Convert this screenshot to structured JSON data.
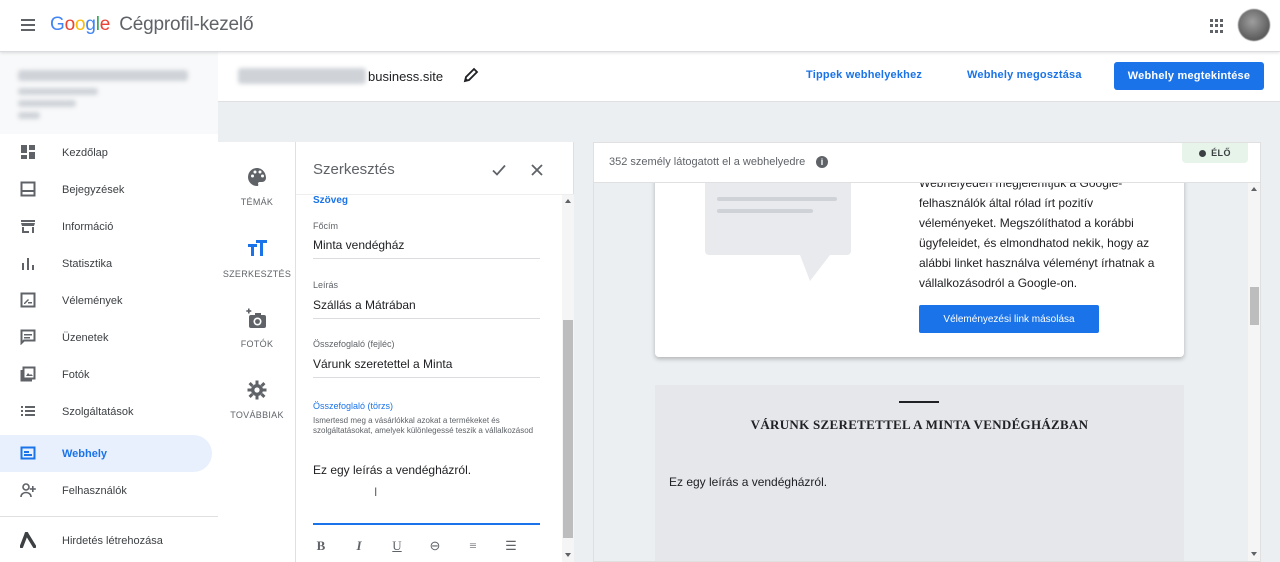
{
  "topbar": {
    "logo": {
      "G": "G",
      "o1": "o",
      "o2": "o",
      "g": "g",
      "l": "l",
      "e": "e"
    },
    "product_name": "Cégprofil-kezelő",
    "icons": {
      "menu": "menu-icon",
      "apps": "apps-grid-icon",
      "avatar": "account-avatar"
    }
  },
  "sidebar": {
    "items": [
      {
        "label": "Kezdőlap",
        "icon": "dashboard-icon"
      },
      {
        "label": "Bejegyzések",
        "icon": "posts-icon"
      },
      {
        "label": "Információ",
        "icon": "store-icon"
      },
      {
        "label": "Statisztika",
        "icon": "bar-chart-icon"
      },
      {
        "label": "Vélemények",
        "icon": "reviews-icon"
      },
      {
        "label": "Üzenetek",
        "icon": "messages-icon"
      },
      {
        "label": "Fotók",
        "icon": "photos-icon"
      },
      {
        "label": "Szolgáltatások",
        "icon": "services-list-icon"
      },
      {
        "label": "Webhely",
        "icon": "website-icon",
        "active": true
      },
      {
        "label": "Felhasználók",
        "icon": "add-user-icon"
      },
      {
        "label": "Hirdetés létrehozása",
        "icon": "google-ads-icon"
      }
    ]
  },
  "site_header": {
    "url_suffix": "business.site",
    "tips_link": "Tippek webhelyekhez",
    "share_link": "Webhely megosztása",
    "view_button": "Webhely megtekintése"
  },
  "tools": [
    {
      "label": "TÉMÁK",
      "icon": "palette-icon"
    },
    {
      "label": "SZERKESZTÉS",
      "icon": "text-format-icon",
      "active": true
    },
    {
      "label": "FOTÓK",
      "icon": "add-photo-icon"
    },
    {
      "label": "TOVÁBBIAK",
      "icon": "gear-icon"
    }
  ],
  "editor": {
    "title": "Szerkesztés",
    "section": "Szöveg",
    "fields": [
      {
        "label": "Főcím",
        "value": "Minta vendégház"
      },
      {
        "label": "Leírás",
        "value": "Szállás a Mátrában"
      },
      {
        "label": "Összefoglaló (fejléc)",
        "value": "Várunk szeretettel a Minta"
      }
    ],
    "body": {
      "label": "Összefoglaló (törzs)",
      "help": "Ismertesd meg a vásárlókkal azokat a termékeket és szolgáltatásokat, amelyek különlegessé teszik a vállalkozásod",
      "value": "Ez egy leírás a vendégházról.",
      "cursor": "I"
    },
    "format_buttons": [
      {
        "glyph": "B",
        "icon": "bold-icon"
      },
      {
        "glyph": "I",
        "icon": "italic-icon"
      },
      {
        "glyph": "U",
        "icon": "underline-icon"
      },
      {
        "glyph": "⊖",
        "icon": "link-icon"
      },
      {
        "glyph": "≡",
        "icon": "numbered-list-icon"
      },
      {
        "glyph": "☰",
        "icon": "bulleted-list-icon"
      }
    ]
  },
  "preview": {
    "visitors": "352 személy látogatott el a webhelyedre",
    "info_glyph": "i",
    "live_badge": "ÉLŐ",
    "review_text": "Webhelyeden megjelenítjük a Google-felhasználók által rólad írt pozitív véleményeket. Megszólíthatod a korábbi ügyfeleidet, és elmondhatod nekik, hogy az alábbi linket használva véleményt írhatnak a vállalkozásodról a Google-on.",
    "review_button": "Véleményezési link másolása",
    "site_heading": "VÁRUNK SZERETETTEL A MINTA VENDÉGHÁZBAN",
    "site_body": "Ez egy leírás a vendégházról."
  },
  "colors": {
    "accent": "#1a73e8",
    "active_bg": "#e8f0fe",
    "live_bg": "#e6f4ea",
    "workspace": "#eceff1"
  }
}
